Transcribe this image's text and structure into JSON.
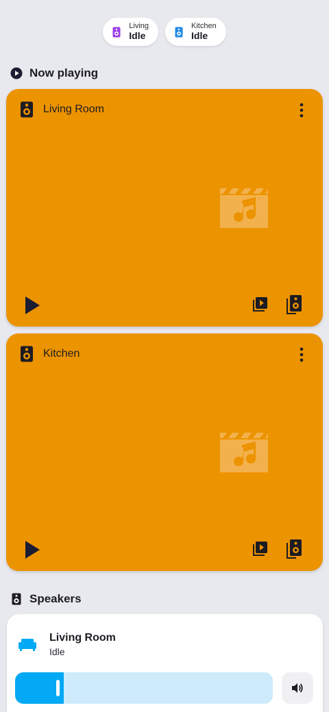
{
  "chips": [
    {
      "area": "Living",
      "state": "Idle",
      "icon": "speaker-icon",
      "color": "#9c3ee8"
    },
    {
      "area": "Kitchen",
      "state": "Idle",
      "icon": "speaker-icon",
      "color": "#1e88e5"
    }
  ],
  "now_playing": {
    "title": "Now playing",
    "icon": "play-circle-icon",
    "players": [
      {
        "name": "Living Room",
        "state": "Idle",
        "color": "#ec9300"
      },
      {
        "name": "Kitchen",
        "state": "Idle",
        "color": "#ec9300"
      }
    ]
  },
  "speakers": {
    "title": "Speakers",
    "icon": "speaker-icon",
    "items": [
      {
        "name": "Living Room",
        "state": "Idle",
        "icon": "sofa-icon",
        "volume": 0.19,
        "accent": "#03a9f4"
      }
    ]
  }
}
